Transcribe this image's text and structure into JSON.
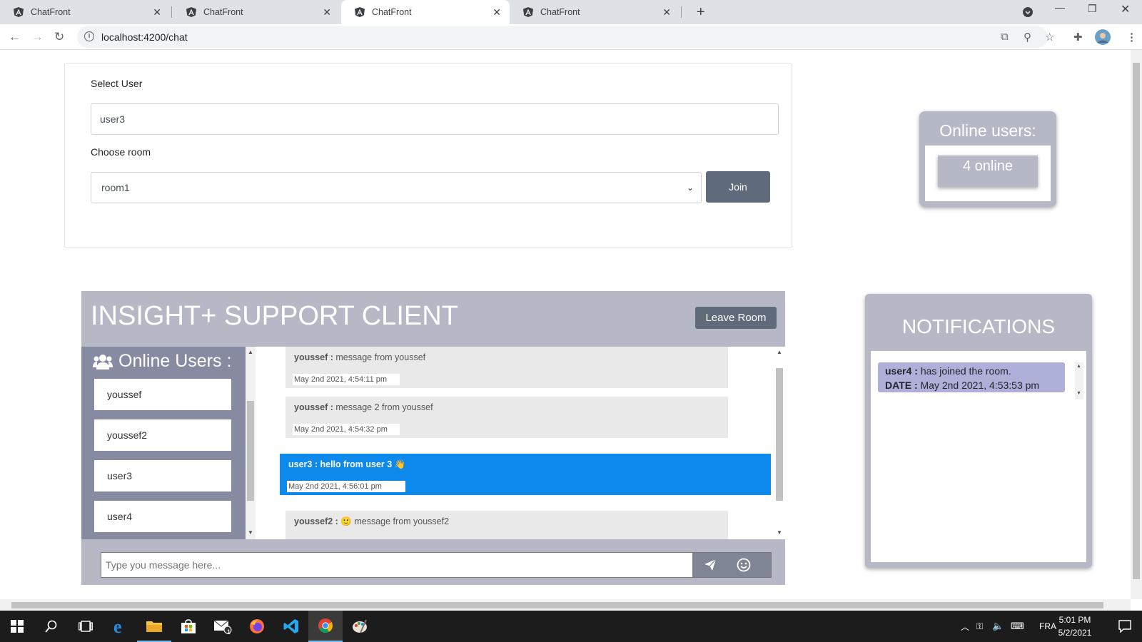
{
  "browser": {
    "tabs": [
      {
        "title": "ChatFront",
        "active": false
      },
      {
        "title": "ChatFront",
        "active": false
      },
      {
        "title": "ChatFront",
        "active": true
      },
      {
        "title": "ChatFront",
        "active": false
      }
    ],
    "url": "localhost:4200/chat"
  },
  "form": {
    "select_user_label": "Select User",
    "user_value": "user3",
    "choose_room_label": "Choose room",
    "room_value": "room1",
    "join_label": "Join"
  },
  "online": {
    "title": "Online users:",
    "count_text": "4 online"
  },
  "chat": {
    "title": "INSIGHT+ SUPPORT CLIENT",
    "leave_label": "Leave Room",
    "users_header": "Online Users :",
    "users": [
      "youssef",
      "youssef2",
      "user3",
      "user4"
    ],
    "messages": [
      {
        "user": "youssef :",
        "text": "message from youssef",
        "date": "May 2nd 2021, 4:54:11 pm",
        "mine": false
      },
      {
        "user": "youssef :",
        "text": "message 2 from youssef",
        "date": "May 2nd 2021, 4:54:32 pm",
        "mine": false
      },
      {
        "user": "user3 :",
        "text": "hello from user 3 👋",
        "date": "May 2nd 2021, 4:56:01 pm",
        "mine": true
      },
      {
        "user": "youssef2 :",
        "text": "🙂 message from youssef2",
        "date": "",
        "mine": false
      }
    ],
    "message_placeholder": "Type you message here..."
  },
  "notifications": {
    "title": "NOTIFICATIONS",
    "items": [
      {
        "user": "user4 :",
        "text": "has joined the room.",
        "date_label": "DATE :",
        "date": "May 2nd 2021, 4:53:53 pm"
      }
    ]
  },
  "taskbar": {
    "language": "FRA",
    "time": "5:01 PM",
    "date": "5/2/2021",
    "mail_badge": "1"
  },
  "colors": {
    "panel": "#b6b8c6",
    "users_column": "#878ba1",
    "own_message": "#0d89ec",
    "button": "#5f6b7a",
    "notification": "#aeb0da"
  }
}
